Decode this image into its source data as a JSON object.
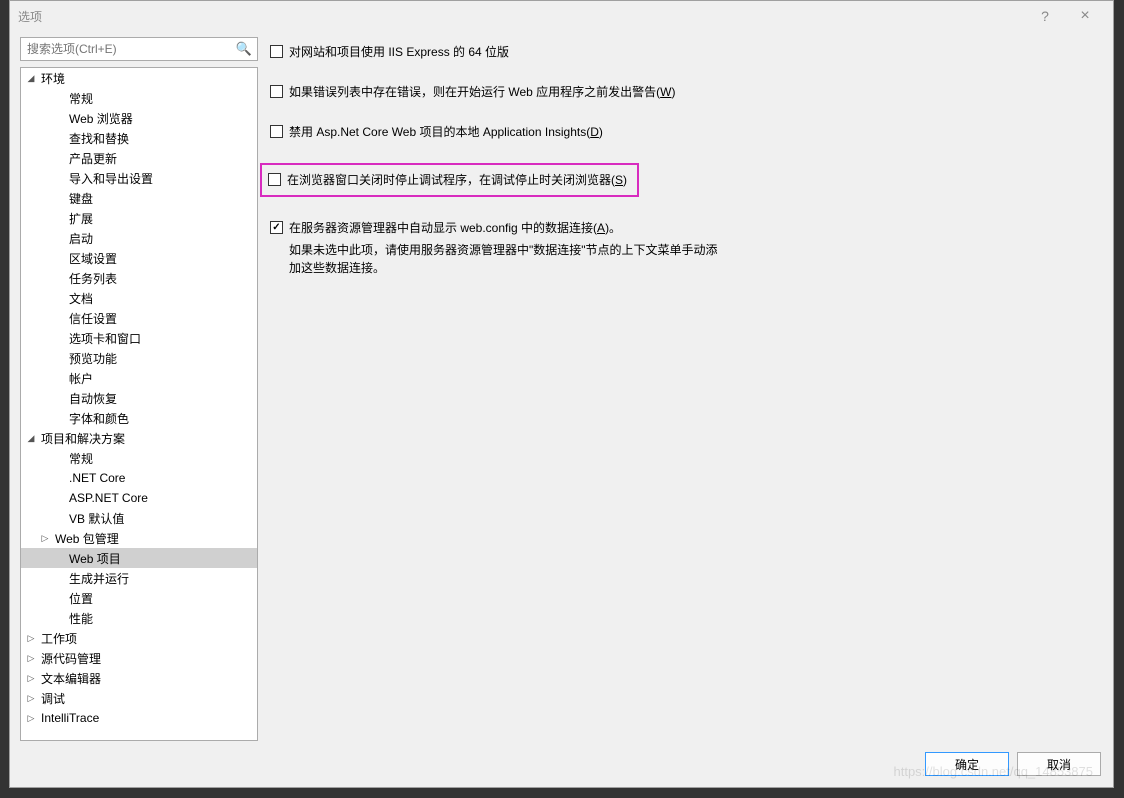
{
  "window": {
    "title": "选项",
    "help_tooltip": "?",
    "close_tooltip": "×"
  },
  "search": {
    "placeholder": "搜索选项(Ctrl+E)"
  },
  "tree": [
    {
      "label": "环境",
      "depth": 0,
      "expanded": true
    },
    {
      "label": "常规",
      "depth": 2
    },
    {
      "label": "Web 浏览器",
      "depth": 2
    },
    {
      "label": "查找和替换",
      "depth": 2
    },
    {
      "label": "产品更新",
      "depth": 2
    },
    {
      "label": "导入和导出设置",
      "depth": 2
    },
    {
      "label": "键盘",
      "depth": 2
    },
    {
      "label": "扩展",
      "depth": 2
    },
    {
      "label": "启动",
      "depth": 2
    },
    {
      "label": "区域设置",
      "depth": 2
    },
    {
      "label": "任务列表",
      "depth": 2
    },
    {
      "label": "文档",
      "depth": 2
    },
    {
      "label": "信任设置",
      "depth": 2
    },
    {
      "label": "选项卡和窗口",
      "depth": 2
    },
    {
      "label": "预览功能",
      "depth": 2
    },
    {
      "label": "帐户",
      "depth": 2
    },
    {
      "label": "自动恢复",
      "depth": 2
    },
    {
      "label": "字体和颜色",
      "depth": 2
    },
    {
      "label": "项目和解决方案",
      "depth": 0,
      "expanded": true
    },
    {
      "label": "常规",
      "depth": 2
    },
    {
      "label": ".NET Core",
      "depth": 2
    },
    {
      "label": "ASP.NET Core",
      "depth": 2
    },
    {
      "label": "VB 默认值",
      "depth": 2
    },
    {
      "label": "Web 包管理",
      "depth": 1,
      "collapsed": true
    },
    {
      "label": "Web 项目",
      "depth": 2,
      "selected": true
    },
    {
      "label": "生成并运行",
      "depth": 2
    },
    {
      "label": "位置",
      "depth": 2
    },
    {
      "label": "性能",
      "depth": 2
    },
    {
      "label": "工作项",
      "depth": 0,
      "collapsed": true
    },
    {
      "label": "源代码管理",
      "depth": 0,
      "collapsed": true
    },
    {
      "label": "文本编辑器",
      "depth": 0,
      "collapsed": true
    },
    {
      "label": "调试",
      "depth": 0,
      "collapsed": true
    },
    {
      "label": "IntelliTrace",
      "depth": 0,
      "collapsed": true
    }
  ],
  "options": {
    "opt1": {
      "label": "对网站和项目使用 IIS Express 的 64 位版",
      "checked": false
    },
    "opt2": {
      "label_pre": "如果错误列表中存在错误，则在开始运行 Web 应用程序之前发出警告(",
      "mn": "W",
      "label_post": ")",
      "checked": false
    },
    "opt3": {
      "label_pre": "禁用 Asp.Net Core Web 项目的本地 Application Insights(",
      "mn": "D",
      "label_post": ")",
      "checked": false
    },
    "opt4": {
      "label_pre": "在浏览器窗口关闭时停止调试程序，在调试停止时关闭浏览器(",
      "mn": "S",
      "label_post": ")",
      "checked": false
    },
    "opt5": {
      "label_pre": "在服务器资源管理器中自动显示 web.config 中的数据连接(",
      "mn": "A",
      "label_post": ")。",
      "checked": true,
      "sub": "如果未选中此项，请使用服务器资源管理器中\"数据连接\"节点的上下文菜单手动添加这些数据连接。"
    }
  },
  "buttons": {
    "ok": "确定",
    "cancel": "取消"
  },
  "watermark": "https://blog.csdn.net/qq_14853875"
}
